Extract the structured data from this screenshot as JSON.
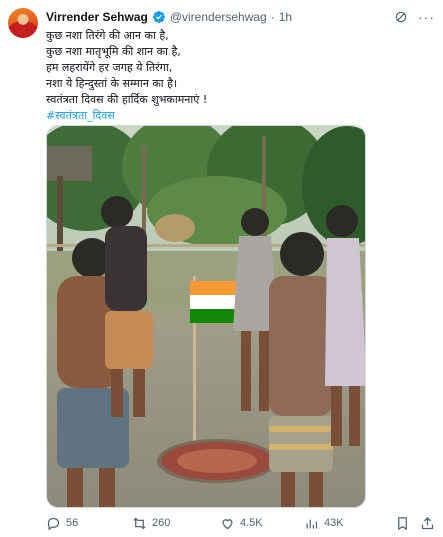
{
  "author": {
    "display_name": "Virrender Sehwag",
    "handle": "@virendersehwag",
    "separator": "·",
    "time": "1h"
  },
  "tweet": {
    "lines": [
      "कुछ नशा तिरंगे की आन का है,",
      "कुछ नशा मातृभूमि की शान का है,",
      "हम लहरायेंगे हर जगह ये तिरंगा,",
      "नशा ये हिन्दुस्तां के सम्मान का है।",
      "स्वतंत्रता दिवस की हार्दिक शुभकामनाएं !"
    ],
    "hashtag": "#स्वतंत्रता_दिवस"
  },
  "media": {
    "alt": "",
    "flag_colors": [
      "#ff9933",
      "#ffffff",
      "#138808"
    ]
  },
  "actions": {
    "replies": "56",
    "retweets": "260",
    "likes": "4.5K",
    "views": "43K"
  },
  "icons": {
    "verified": "verified-badge-icon",
    "grok": "grok-icon",
    "more": "more-icon",
    "reply": "reply-icon",
    "retweet": "retweet-icon",
    "like": "heart-icon",
    "views": "views-icon",
    "bookmark": "bookmark-icon",
    "share": "share-icon"
  },
  "colors": {
    "text": "#0f1419",
    "secondary": "#536471",
    "link": "#1d9bf0",
    "verified": "#1d9bf0"
  }
}
